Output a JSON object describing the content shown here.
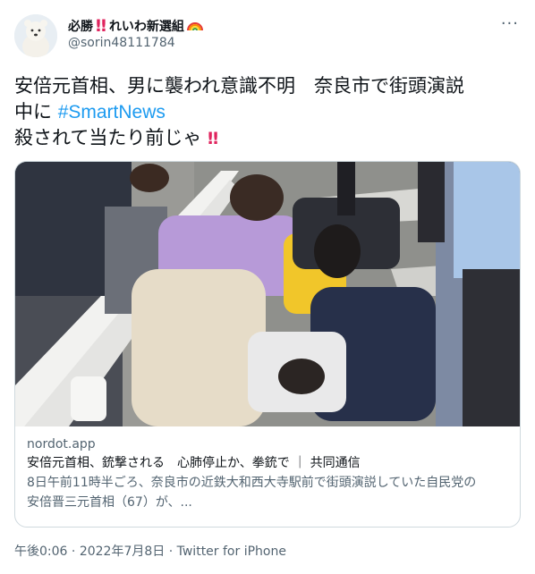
{
  "author": {
    "display_name": "必勝",
    "display_name_suffix": "れいわ新選組",
    "handle": "@sorin48111784",
    "avatar_icon": "polar-bear-avatar-icon"
  },
  "tweet": {
    "line1": "安倍元首相、男に襲われ意識不明　奈良市で街頭演説",
    "line2_prefix": "中に ",
    "hashtag": "#SmartNews",
    "line3": "殺されて当たり前じゃ",
    "emphasis": "‼"
  },
  "link_card": {
    "domain": "nordot.app",
    "title": "安倍元首相、銃撃される　心肺停止か、拳銃で ｜ 共同通信",
    "description_line1": "8日午前11時半ごろ、奈良市の近鉄大和西大寺駅前で街頭演説していた自民党の",
    "description_line2": "安倍晋三元首相（67）が、..."
  },
  "meta": {
    "time": "午後0:06",
    "separator": "·",
    "date": "2022年7月8日",
    "source": "Twitter for iPhone"
  },
  "more_label": "···",
  "colors": {
    "link": "#1d9bf0",
    "secondary_text": "#536471",
    "border": "#cfd9de",
    "emphasis": "#e0245e"
  }
}
